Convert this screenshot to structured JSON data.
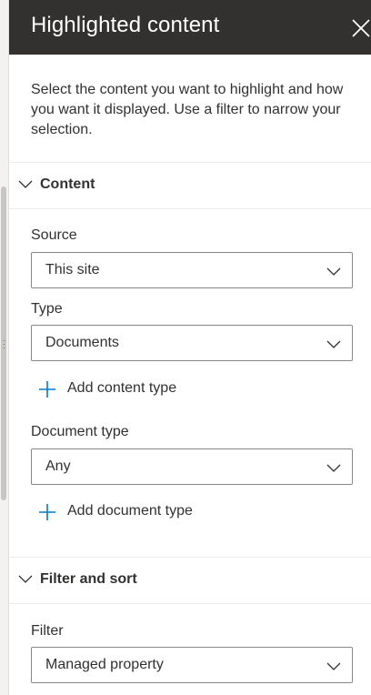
{
  "panel": {
    "title": "Highlighted content",
    "description": "Select the content you want to highlight and how you want it displayed. Use a filter to narrow your selection."
  },
  "sections": {
    "content": {
      "label": "Content",
      "source": {
        "label": "Source",
        "value": "This site"
      },
      "type": {
        "label": "Type",
        "value": "Documents"
      },
      "add_content_type": "Add content type",
      "document_type": {
        "label": "Document type",
        "value": "Any"
      },
      "add_document_type": "Add document type"
    },
    "filter_sort": {
      "label": "Filter and sort",
      "filter": {
        "label": "Filter",
        "value": "Managed property"
      }
    }
  },
  "colors": {
    "header_bg": "#323130",
    "header_text": "#ffffff",
    "accent": "#0078d4",
    "text": "#323130",
    "border": "#8a8886"
  },
  "icons": {
    "close": "close-icon",
    "chevron": "chevron-down-icon",
    "plus": "plus-icon"
  }
}
